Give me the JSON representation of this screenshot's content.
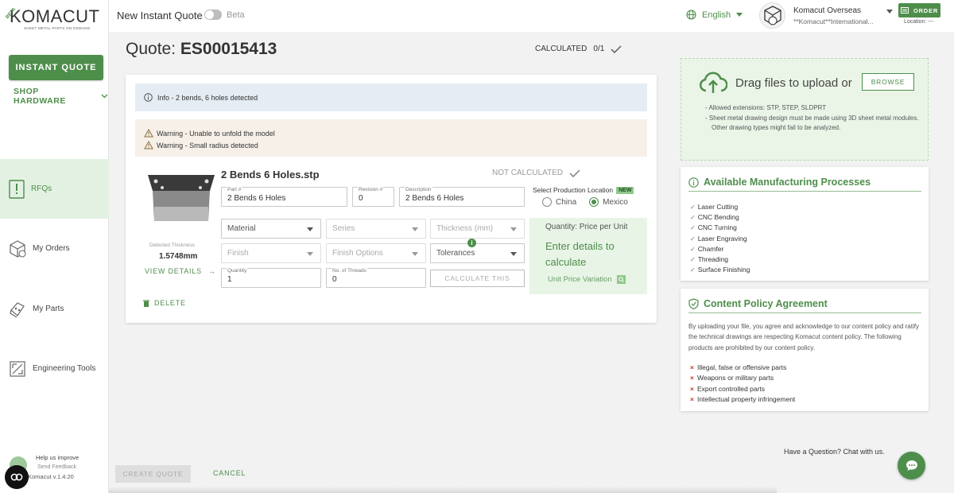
{
  "sidebar": {
    "logo": "KOMACUT",
    "logo_tag": "SHEET METAL PARTS ON DEMAND",
    "beta": "BETA",
    "instant_quote": "INSTANT QUOTE",
    "shop_hardware": "SHOP HARDWARE",
    "items": [
      {
        "label": "RFQs",
        "icon": "rfq-icon",
        "active": true
      },
      {
        "label": "My Orders",
        "icon": "orders-icon"
      },
      {
        "label": "My Parts",
        "icon": "parts-icon"
      },
      {
        "label": "Engineering Tools",
        "icon": "tools-icon"
      }
    ],
    "help_line1": "Help us improve",
    "help_line2": "Send Feedback",
    "version": "Komacut v.1.4.20"
  },
  "topbar": {
    "title": "New Instant Quote",
    "beta": "Beta",
    "language": "English",
    "user_name": "Komacut Overseas",
    "user_sub": "**Komacut**International...",
    "order": "ORDER",
    "location": "Location: ---"
  },
  "quote": {
    "title_prefix": "Quote:",
    "number": "ES00015413",
    "calculated": "CALCULATED",
    "calculated_count": "0/1"
  },
  "card": {
    "info": "Info - 2 bends, 6 holes detected",
    "warnings": [
      "Warning - Unable to unfold the model",
      "Warning - Small radius detected"
    ],
    "file_name": "2 Bends 6 Holes.stp",
    "status": "NOT CALCULATED",
    "thickness_label": "Detected Thickness",
    "thickness_value": "1.5748mm",
    "view_details": "VIEW DETAILS",
    "delete": "DELETE",
    "part_label": "Part #",
    "part_value": "2 Bends 6 Holes",
    "revision_label": "Revision #",
    "revision_value": "0",
    "description_label": "Description",
    "description_value": "2 Bends 6 Holes",
    "material": "Material",
    "series": "Series",
    "thickness": "Thickness (mm)",
    "finish": "Finish",
    "finish_options": "Finish Options",
    "tolerances": "Tolerances",
    "quantity_label": "Quantity",
    "quantity_value": "1",
    "threads_label": "No. of Threads",
    "threads_value": "0",
    "calculate": "CALCULATE THIS",
    "production_location": "Select Production Location",
    "new_badge": "NEW",
    "location_options": [
      "China",
      "Mexico"
    ],
    "selected_location": "Mexico",
    "price_qty": "Quantity: Price per Unit",
    "enter_details": "Enter details to calculate",
    "unit_price_variation": "Unit Price Variation"
  },
  "upload": {
    "drag": "Drag files to upload or",
    "browse": "BROWSE",
    "notes": [
      "- Allowed extensions: STP, STEP, SLDPRT",
      "- Sheet metal drawing design must be made using 3D sheet metal modules.",
      "Other drawing types might fail to be analyzed."
    ]
  },
  "processes": {
    "title": "Available Manufacturing Processes",
    "items": [
      "Laser Cutting",
      "CNC Bending",
      "CNC Turning",
      "Laser Engraving",
      "Chamfer",
      "Threading",
      "Surface Finishing"
    ]
  },
  "policy": {
    "title": "Content Policy Agreement",
    "text": "By uploading your file, you agree and acknowledge to our content policy and ratify the technical drawings are respecting Komacut content policy. The following products are prohibited by our content policy.",
    "prohibited": [
      "Illegal, false or offensive parts",
      "Weapons or military parts",
      "Export controlled parts",
      "Intellectual property infringement"
    ]
  },
  "chat": {
    "question": "Have a Question? Chat with us."
  },
  "footer": {
    "create": "CREATE QUOTE",
    "cancel": "CANCEL"
  },
  "colors": {
    "brand": "#4e8e4b",
    "info_bg": "#e5ecf4",
    "warn_bg": "#f6f0e8"
  }
}
